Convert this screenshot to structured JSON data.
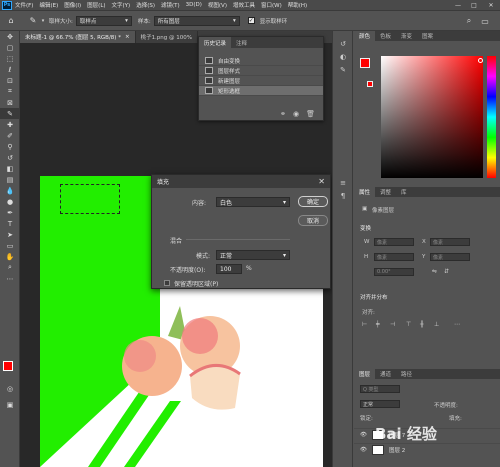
{
  "menubar": {
    "logo": "Ps",
    "items": [
      "文件(F)",
      "编辑(E)",
      "图像(I)",
      "图层(L)",
      "文字(Y)",
      "选择(S)",
      "滤镜(T)",
      "3D(D)",
      "视图(V)",
      "增效工具",
      "窗口(W)",
      "帮助(H)"
    ],
    "minimize": "—",
    "maximize": "□",
    "close": "✕"
  },
  "options": {
    "sample_size_label": "取样大小:",
    "sample_size_value": "取样点",
    "sample_label": "样本:",
    "sample_value": "所有图层",
    "show_ring_label": "显示取样环"
  },
  "tabs": [
    {
      "label": "未标题-1 @ 66.7% (图层 5, RGB/8) *",
      "close": "×"
    },
    {
      "label": "桃子1.png @ 100%",
      "close": ""
    }
  ],
  "history_panel": {
    "tabs": [
      "历史记录",
      "注释"
    ],
    "items": [
      {
        "label": "自由变换"
      },
      {
        "label": "图层样式"
      },
      {
        "label": "新建图层"
      },
      {
        "label": "矩形选框"
      }
    ],
    "footer_icons": [
      "new-snapshot-icon",
      "camera-icon",
      "trash-icon"
    ]
  },
  "fill_dialog": {
    "title": "填充",
    "content_label": "内容:",
    "content_value": "白色",
    "ok": "确定",
    "cancel": "取消",
    "blending_label": "混合",
    "mode_label": "模式:",
    "mode_value": "正常",
    "opacity_label": "不透明度(O):",
    "opacity_value": "100",
    "opacity_unit": "%",
    "preserve_label": "保留透明区域(P)"
  },
  "right_panel": {
    "color_tabs": [
      "颜色",
      "色板",
      "渐变",
      "图案"
    ],
    "props_tabs": [
      "属性",
      "调整",
      "库"
    ],
    "pixel_layer_label": "像素图层",
    "transform_label": "变换",
    "w_label": "W",
    "h_label": "H",
    "x_label": "X",
    "y_label": "Y",
    "w_value": "像素",
    "h_value": "像素",
    "x_value": "像素",
    "y_value": "像素",
    "angle_value": "0.00°",
    "align_label": "对齐并分布",
    "align_sub": "对齐:",
    "layers_tabs": [
      "图层",
      "通道",
      "路径"
    ],
    "layers_search": "Q 类型",
    "blend_mode": "正常",
    "opacity_label": "不透明度:",
    "lock_label": "锁定:",
    "fill_label": "填充:",
    "layers": [
      {
        "name": "图层 7"
      },
      {
        "name": "图层 2"
      }
    ]
  },
  "colors": {
    "foreground": "#ff0000",
    "background": "#ffffff",
    "canvas_green": "#22ee00",
    "accent": "#31a8ff"
  },
  "watermark": "Bai 经验"
}
